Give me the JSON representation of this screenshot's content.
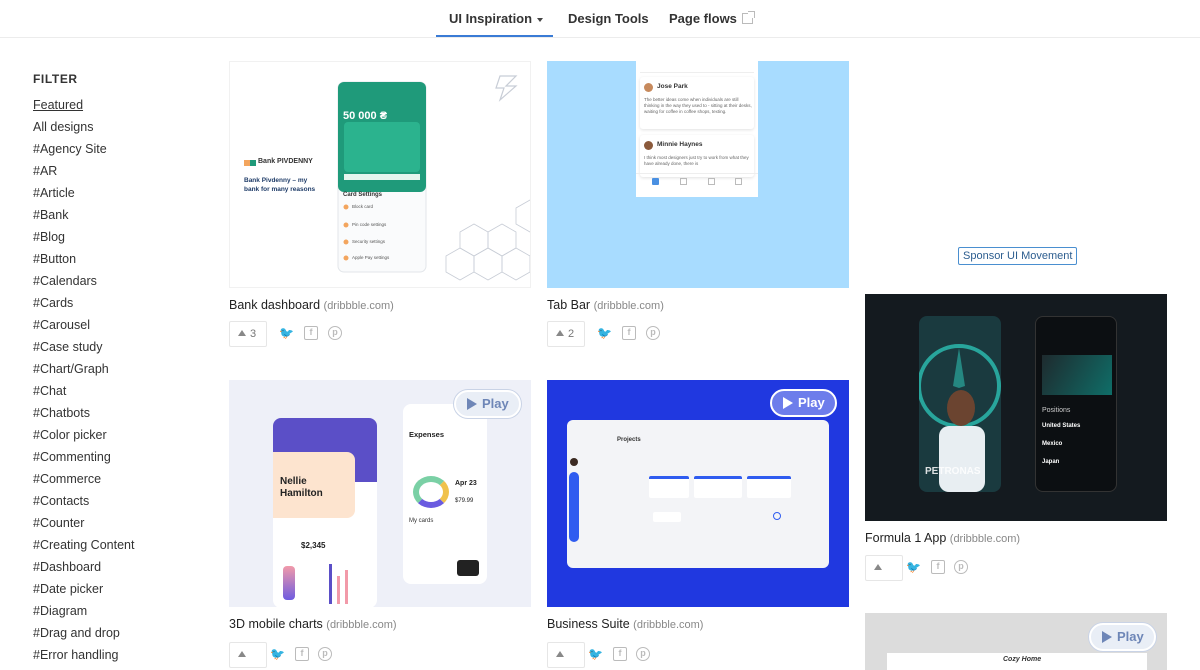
{
  "nav": {
    "items": [
      {
        "label": "UI Inspiration"
      },
      {
        "label": "Design Tools"
      },
      {
        "label": "Page flows"
      }
    ]
  },
  "sidebar": {
    "title": "FILTER",
    "items": [
      "Featured",
      "All designs",
      "#Agency Site",
      "#AR",
      "#Article",
      "#Bank",
      "#Blog",
      "#Button",
      "#Calendars",
      "#Cards",
      "#Carousel",
      "#Case study",
      "#Chart/Graph",
      "#Chat",
      "#Chatbots",
      "#Color picker",
      "#Commenting",
      "#Commerce",
      "#Contacts",
      "#Counter",
      "#Creating Content",
      "#Dashboard",
      "#Date picker",
      "#Diagram",
      "#Drag and drop",
      "#Error handling"
    ]
  },
  "cards": [
    {
      "title": "Bank dashboard",
      "source": "(dribbble.com)",
      "votes": "3",
      "thumb": {
        "brand": "Bank PIVDENNY",
        "tagline": "Bank Pivdenny – my bank for many reasons",
        "balance": "50 000 ₴",
        "section": "Card Settings",
        "settings": [
          "Block card",
          "Pin code settings",
          "Security settings",
          "Apple Pay settings"
        ]
      }
    },
    {
      "title": "Tab Bar",
      "source": "(dribbble.com)",
      "votes": "2",
      "thumb": {
        "names": [
          "Jose Park",
          "Minnie Haynes"
        ],
        "text1": "The better ideas come when individuals are still thinking in the way they used to - sitting at their desks, waiting for coffee in coffee shops, texting.",
        "text2": "I think most designers just try to work from what they have already done, there is"
      }
    },
    {
      "title": "3D mobile charts",
      "source": "(dribbble.com)",
      "votes": "",
      "play": "Play",
      "thumb": {
        "greeting": "Nellie Hamilton",
        "amount": "$2,345",
        "expenses": "Expenses",
        "date": "Apr 23",
        "price": "$79.99",
        "my_cards": "My cards"
      }
    },
    {
      "title": "Business Suite",
      "source": "(dribbble.com)",
      "votes": "",
      "play": "Play",
      "thumb": {
        "header": "Projects"
      }
    },
    {
      "title": "Formula 1 App",
      "source": "(dribbble.com)",
      "votes": "",
      "thumb": {
        "poster": "PETRONAS",
        "list_title": "Positions",
        "countries": [
          "United States",
          "Mexico",
          "Japan"
        ]
      }
    },
    {
      "title": "",
      "source": "",
      "votes": "",
      "play": "Play",
      "thumb": {
        "site": "Cozy Home"
      }
    }
  ],
  "sponsor_label": "Sponsor UI Movement",
  "colors": {
    "accent": "#3a7bd5",
    "bank_green": "#1f9a7a",
    "tabbar_sky": "#a8dcff",
    "charts_purple": "#5b4fc7",
    "business_blue": "#2038e0",
    "f1_dark": "#141a1f"
  }
}
